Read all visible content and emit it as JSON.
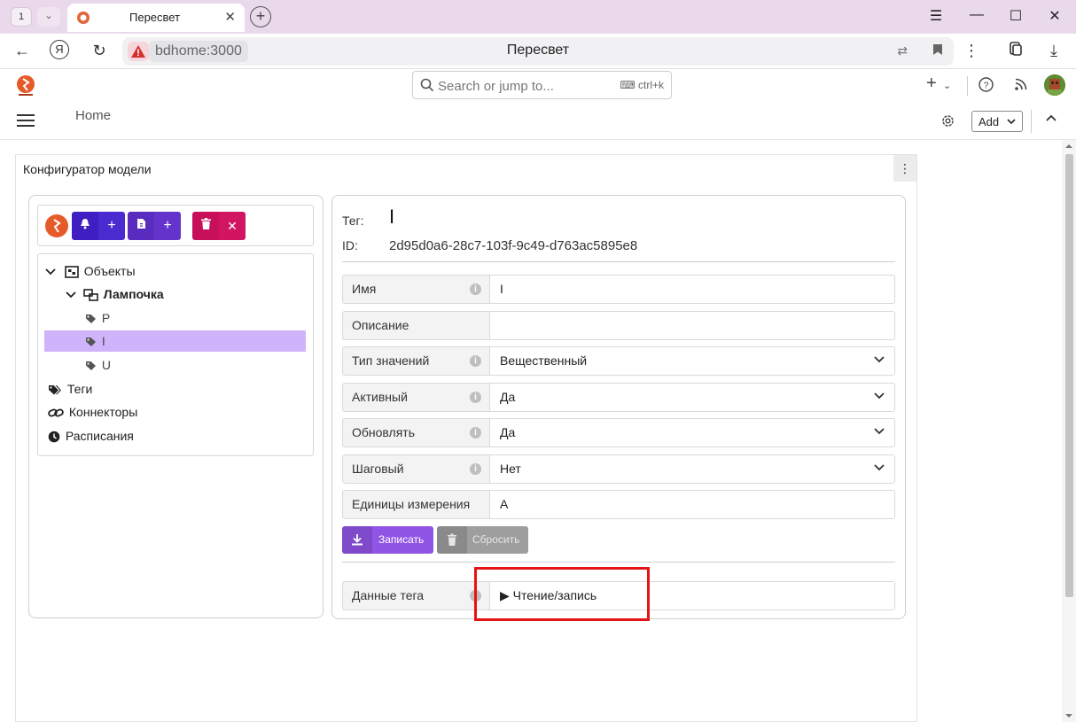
{
  "browser": {
    "tab_count": "1",
    "tab_title": "Пересвет",
    "host": "bdhome:3000",
    "page_title": "Пересвет"
  },
  "header": {
    "search_placeholder": "Search or jump to...",
    "search_shortcut": "ctrl+k",
    "breadcrumb": "Home",
    "add_label": "Add"
  },
  "panel": {
    "title": "Конфигуратор модели"
  },
  "tree": {
    "items": [
      {
        "label": "Объекты"
      },
      {
        "label": "Лампочка"
      },
      {
        "label": "P"
      },
      {
        "label": "I"
      },
      {
        "label": "U"
      },
      {
        "label": "Теги"
      },
      {
        "label": "Коннекторы"
      },
      {
        "label": "Расписания"
      }
    ]
  },
  "tag": {
    "tag_label": "Тег:",
    "tag_value": "I",
    "id_label": "ID:",
    "id_value": "2d95d0a6-28c7-103f-9c49-d763ac5895e8"
  },
  "form": {
    "fields": [
      {
        "label": "Имя",
        "value": "I"
      },
      {
        "label": "Описание",
        "value": ""
      },
      {
        "label": "Тип значений",
        "value": "Вещественный"
      },
      {
        "label": "Активный",
        "value": "Да"
      },
      {
        "label": "Обновлять",
        "value": "Да"
      },
      {
        "label": "Шаговый",
        "value": "Нет"
      },
      {
        "label": "Единицы измерения",
        "value": "A"
      }
    ],
    "save_label": "Записать",
    "reset_label": "Сбросить",
    "data_label": "Данные тега",
    "data_summary": "▶ Чтение/запись"
  },
  "colors": {
    "accent": "#9155e6",
    "selected_row": "#d0b4fb",
    "bell_group": "#3f1fc1",
    "file_group": "#5a2bbf",
    "delete_group": "#d11561",
    "highlight": "#e41414"
  }
}
